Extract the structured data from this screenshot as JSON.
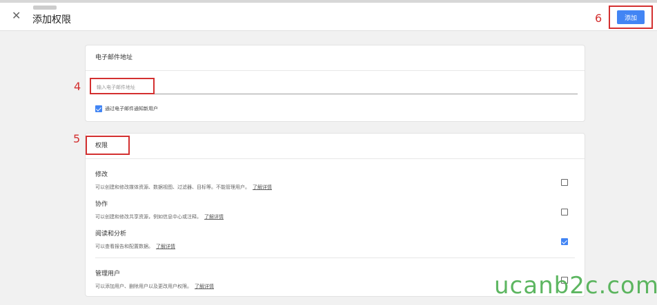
{
  "header": {
    "title": "添加权限",
    "add_label": "添加"
  },
  "annotations": [
    "4",
    "5",
    "6"
  ],
  "email_section": {
    "title": "电子邮件地址",
    "input_placeholder": "输入电子邮件地址",
    "notify_label": "通过电子邮件通知新用户",
    "notify_checked": true
  },
  "permissions_section": {
    "title": "权限",
    "items": [
      {
        "title": "修改",
        "desc": "可以创建和修改媒体资源、数据视图、过滤器、目标等。不能管理用户。",
        "more": "了解详情",
        "checked": false
      },
      {
        "title": "协作",
        "desc": "可以创建和修改共享资源，例如信息中心或注释。",
        "more": "了解详情",
        "checked": false
      },
      {
        "title": "阅读和分析",
        "desc": "可以查看报告和配置数据。",
        "more": "了解详情",
        "checked": true
      },
      {
        "title": "管理用户",
        "desc": "可以添加用户、删除用户以及更改用户权限。",
        "more": "了解详情",
        "checked": false
      }
    ]
  },
  "watermark": "ucanb2c.com",
  "colors": {
    "accent": "#4285f4",
    "annotation": "#d32f2f",
    "watermark": "#4caf50"
  }
}
